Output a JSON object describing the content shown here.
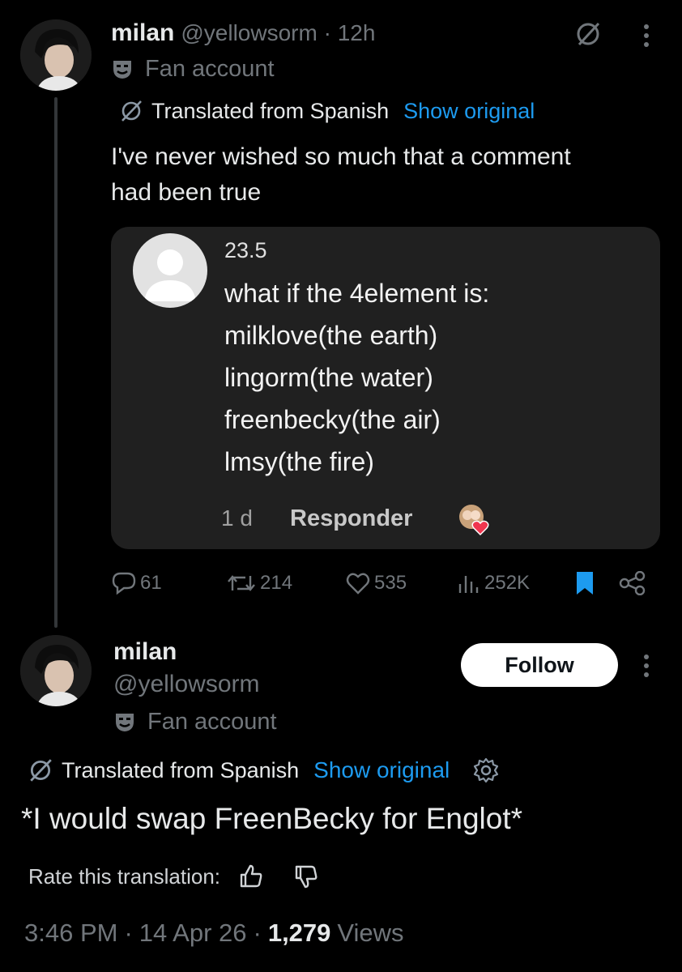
{
  "reply": {
    "author_name": "milan",
    "handle_time": "@yellowsorm · 12h",
    "badge": "Fan account",
    "translated_from": "Translated from Spanish",
    "show_original": "Show original",
    "text_line1": "I've never wished so much that a comment",
    "text_line2": "had been true",
    "embedded_comment": {
      "username": "23.5",
      "lines": [
        "what if the 4element is:",
        "milklove(the earth)",
        "lingorm(the water)",
        "freenbecky(the air)",
        "lmsy(the fire)"
      ],
      "age": "1 d",
      "reply_label": "Responder"
    },
    "stats": {
      "replies": "61",
      "reposts": "214",
      "likes": "535",
      "views": "252K"
    }
  },
  "main_post": {
    "author_name": "milan",
    "handle": "@yellowsorm",
    "badge": "Fan account",
    "follow_label": "Follow",
    "translated_from": "Translated from Spanish",
    "show_original": "Show original",
    "text": "*I would swap FreenBecky for Englot*",
    "rate_translation": "Rate this translation:",
    "time": "3:46 PM",
    "date": "14 Apr 26",
    "views_count": "1,279",
    "views_label": "Views"
  },
  "colors": {
    "accent": "#1d9bf0",
    "muted": "#71767b",
    "background": "#000000",
    "card": "#202020"
  }
}
